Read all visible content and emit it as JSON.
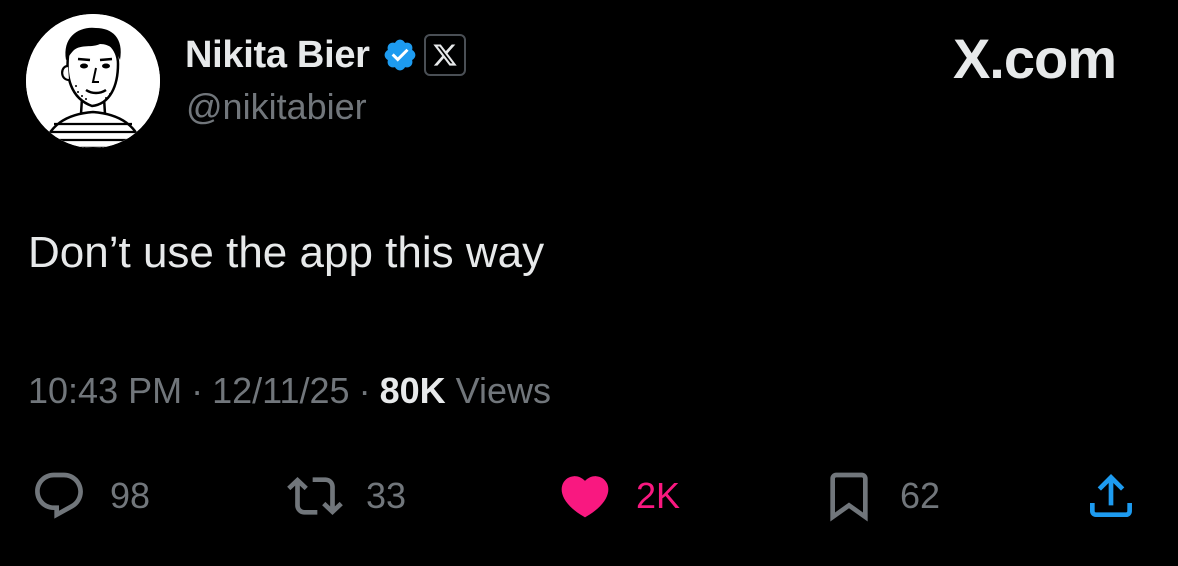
{
  "user": {
    "display_name": "Nikita Bier",
    "handle": "@nikitabier",
    "verified_icon": "verified-badge-icon",
    "affiliate_icon": "x-logo-icon"
  },
  "brand": {
    "text": "X.com"
  },
  "tweet": {
    "text": "Don’t use the app this way"
  },
  "meta": {
    "time": "10:43 PM",
    "separator": "·",
    "date": "12/11/25",
    "views_count": "80K",
    "views_label": "Views"
  },
  "actions": {
    "replies": {
      "icon": "reply-icon",
      "count": "98"
    },
    "reposts": {
      "icon": "repost-icon",
      "count": "33"
    },
    "likes": {
      "icon": "heart-icon",
      "count": "2K"
    },
    "bookmarks": {
      "icon": "bookmark-icon",
      "count": "62"
    },
    "share": {
      "icon": "share-icon"
    }
  },
  "colors": {
    "background": "#000000",
    "text_primary": "#e7e9ea",
    "text_secondary": "#71767b",
    "verified_blue": "#1d9bf0",
    "like_pink": "#f91880"
  }
}
